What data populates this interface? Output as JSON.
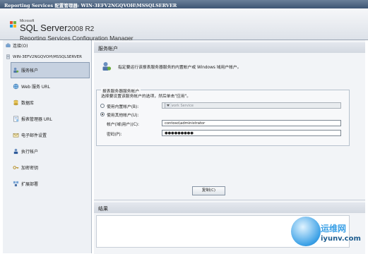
{
  "window": {
    "title": "Reporting Services 配置管理器: WIN-3EFV2NGQVOH\\MSSQLSERVER"
  },
  "header": {
    "microsoft": "Microsoft",
    "product": "SQL Server",
    "version": "2008 R2",
    "subtitle": "Reporting Services Configuration Manager"
  },
  "sidebar": {
    "connect_label": "连接(O)",
    "server": "WIN-3EFV2NGQVOH\\MSSQLSERVER",
    "items": [
      {
        "label": "服务帐户",
        "selected": true,
        "icon": "service-account-icon"
      },
      {
        "label": "Web 服务 URL",
        "icon": "web-service-icon"
      },
      {
        "label": "数据库",
        "icon": "database-icon"
      },
      {
        "label": "报表管理器 URL",
        "icon": "report-manager-icon"
      },
      {
        "label": "电子邮件设置",
        "icon": "email-icon"
      },
      {
        "label": "执行帐户",
        "icon": "execution-account-icon"
      },
      {
        "label": "加密密钥",
        "icon": "encryption-key-icon"
      },
      {
        "label": "扩展部署",
        "icon": "scale-out-icon"
      }
    ]
  },
  "main": {
    "heading": "服务帐户",
    "description": "指定要运行该报表服务器服务的内置帐户或 Windows 域用户帐户。",
    "group": {
      "legend": "报表服务器服务帐户",
      "hint": "选择要设置该服务帐户的选项，然后单击\"应用\"。",
      "builtin_label": "使用内置帐户(B):",
      "builtin_value": "Network Service",
      "other_label": "使用其他帐户(U):",
      "account_label": "帐户(域\\用户)(C):",
      "account_value": "contoso\\administrator",
      "password_label": "密码(P):",
      "password_value": "●●●●●●●●●"
    },
    "results_heading": "结果",
    "apply_label": "复制(C)"
  },
  "watermark": {
    "cn": "运维网",
    "url": "iyunv.com"
  },
  "colors": {
    "titlebar": "#3d5573",
    "selected": "#c6d1e0",
    "accent": "#3aa0e6"
  }
}
